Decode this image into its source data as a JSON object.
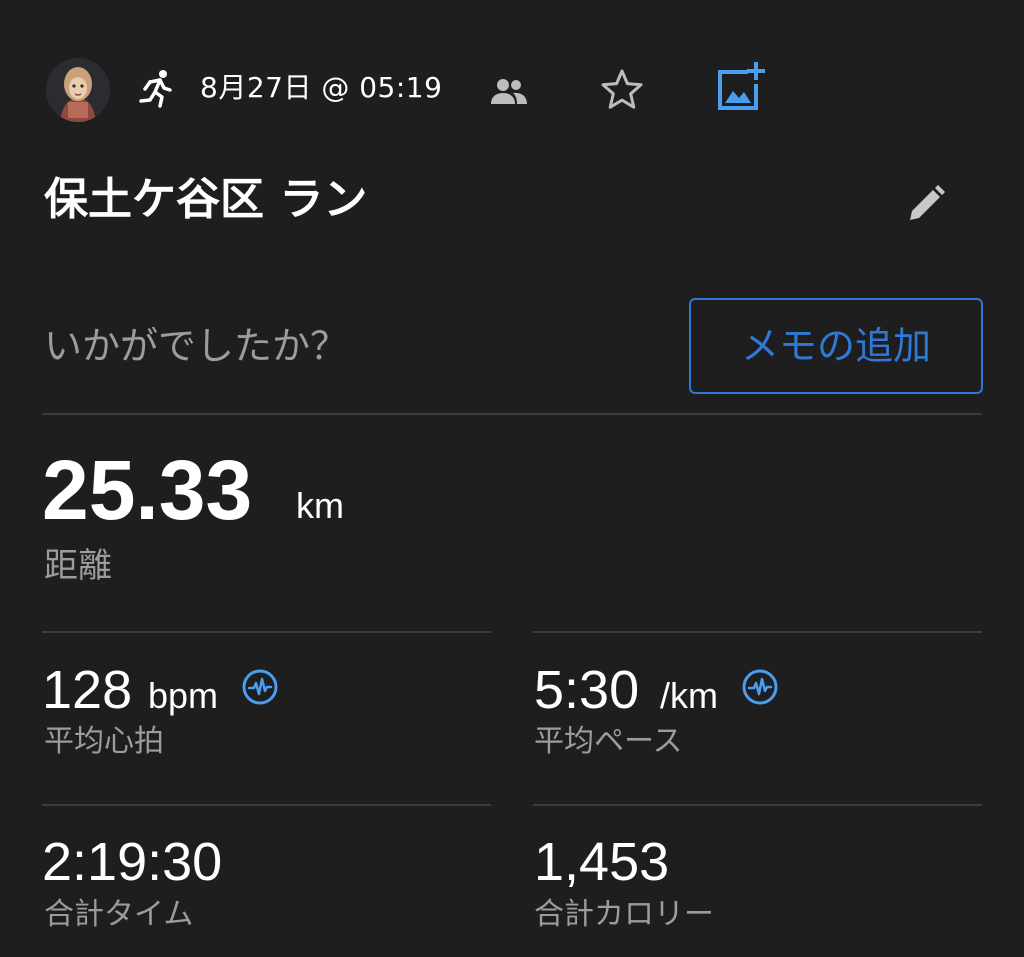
{
  "header": {
    "date_time": "8月27日 @ 05:19",
    "icons": {
      "activity": "running-icon",
      "people": "people-icon",
      "favorite": "star-icon",
      "add_photo": "add-photo-icon"
    }
  },
  "activity": {
    "title": "保土ケ谷区 ラン",
    "edit_icon": "pencil-icon"
  },
  "memo": {
    "prompt": "いかがでしたか？",
    "button_label": "メモの追加"
  },
  "distance": {
    "value": "25.33",
    "unit": "km",
    "label": "距離"
  },
  "stats": {
    "avg_hr": {
      "value": "128",
      "unit": "bpm",
      "label": "平均心拍",
      "icon": "heart-rate-icon"
    },
    "avg_pace": {
      "value": "5:30",
      "unit": "/km",
      "label": "平均ペース",
      "icon": "heart-rate-icon"
    },
    "total_time": {
      "value": "2:19:30",
      "label": "合計タイム"
    },
    "total_calories": {
      "value": "1,453",
      "label": "合計カロリー"
    }
  },
  "colors": {
    "background": "#1e1e1e",
    "accent": "#2f78d6",
    "icon_accent": "#4a9ef0",
    "muted_text": "#9c9c9c",
    "divider": "#3c3c3c"
  }
}
